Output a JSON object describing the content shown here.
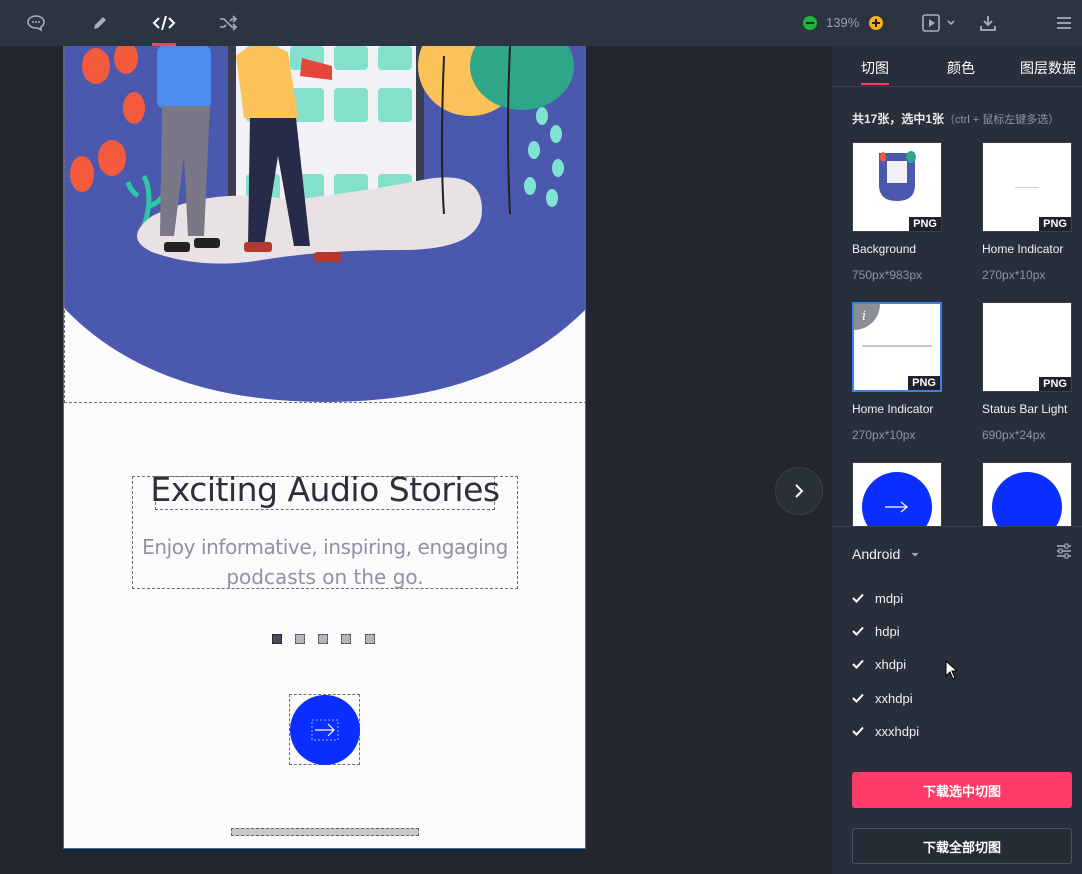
{
  "toolbar": {
    "icons": [
      "comment-icon",
      "pen-icon",
      "code-icon",
      "shuffle-icon",
      "zoom-out-icon",
      "zoom-in-icon",
      "play-icon",
      "download-icon",
      "menu-icon"
    ],
    "zoom": "139%"
  },
  "artboard": {
    "title": "Exciting Audio Stories",
    "subtitle_line1": "Enjoy informative, inspiring, engaging",
    "subtitle_line2": "podcasts on the go.",
    "page_count": 5,
    "active_page": 1
  },
  "panel": {
    "tabs": [
      "切图",
      "颜色",
      "图层数据"
    ],
    "active_tab": "切图",
    "summary": "共17张，选中1张",
    "hint": "（ctrl + 鼠标左键多选）",
    "assets": [
      {
        "name": "Background",
        "size": "750px*983px",
        "badge": "PNG"
      },
      {
        "name": "Home Indicator",
        "size": "270px*10px",
        "badge": "PNG"
      },
      {
        "name": "Home Indicator",
        "size": "270px*10px",
        "badge": "PNG",
        "selected": true
      },
      {
        "name": "Status Bar Light",
        "size": "690px*24px",
        "badge": "PNG"
      },
      {
        "name": "",
        "size": "",
        "badge": ""
      },
      {
        "name": "",
        "size": "",
        "badge": ""
      }
    ],
    "platform": "Android",
    "densities": [
      "mdpi",
      "hdpi",
      "xhdpi",
      "xxhdpi",
      "xxxhdpi"
    ],
    "download_selected": "下载选中切图",
    "download_all": "下载全部切图"
  },
  "colors": {
    "accent": "#ff3b67",
    "blue_button": "#0a2eff",
    "illustration": "#4a58ae"
  }
}
